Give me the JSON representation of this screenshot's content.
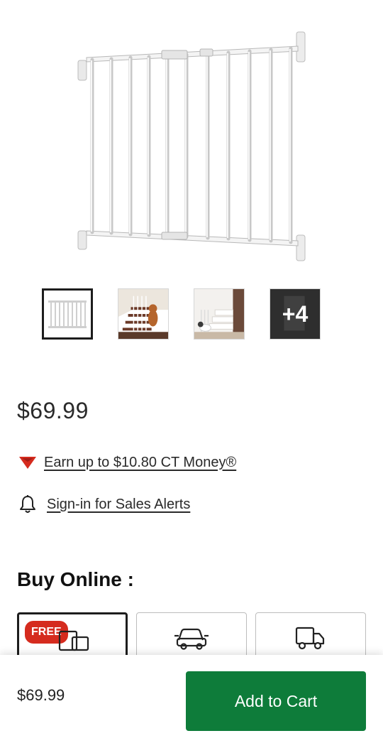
{
  "product": {
    "price": "$69.99",
    "ct_money": {
      "text": "Earn up to $10.80 CT Money®",
      "icon": "canadian-tire-triangle-icon"
    },
    "sales_alerts": {
      "text": "Sign-in for Sales Alerts",
      "icon": "bell-icon"
    }
  },
  "gallery": {
    "thumbnails": [
      {
        "name": "gate-front-view",
        "active": true
      },
      {
        "name": "gate-stairs-dog-view",
        "active": false
      },
      {
        "name": "gate-stairs-installed-view",
        "active": false
      },
      {
        "name": "more-images",
        "active": false,
        "overlay": "+4"
      }
    ]
  },
  "buy_online": {
    "title": "Buy Online :",
    "options": [
      {
        "name": "pickup",
        "badge": "FREE",
        "icon": "store-pickup-icon",
        "selected": true
      },
      {
        "name": "curbside",
        "icon": "car-icon",
        "selected": false
      },
      {
        "name": "delivery",
        "icon": "truck-icon",
        "selected": false
      }
    ]
  },
  "sticky_bar": {
    "price": "$69.99",
    "add_to_cart": "Add to Cart"
  },
  "colors": {
    "cta_green": "#0e7c3a",
    "badge_red": "#d52b1e"
  }
}
